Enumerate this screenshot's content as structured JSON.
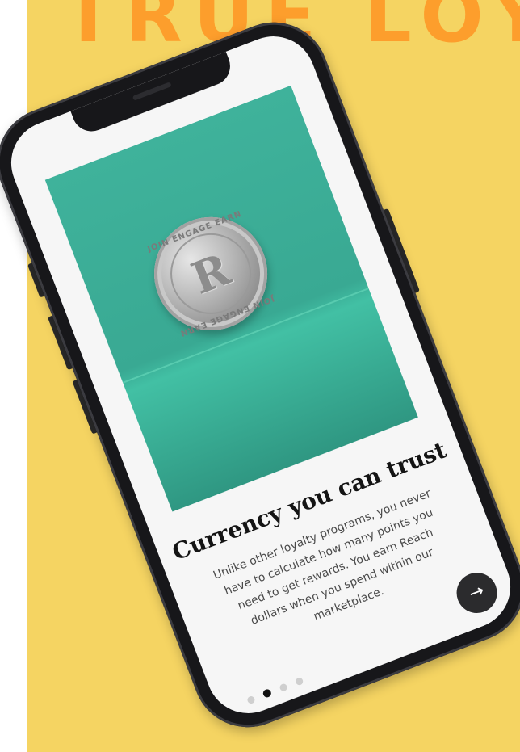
{
  "background": {
    "heading": "TRUE LOY",
    "panel_color": "#f5d462",
    "heading_color": "#fd9e2c"
  },
  "card": {
    "image": {
      "coin_letter": "R",
      "coin_text": "JOIN ENGAGE EARN",
      "color": "#3fb29b"
    },
    "title": "Currency you can trust",
    "body": "Unlike other loyalty programs, you never have to calculate how many points you need to get rewards. You earn Reach dollars when you spend within our marketplace."
  },
  "next_button": {
    "icon": "arrow-right-icon",
    "glyph": "→"
  },
  "pager": {
    "count": 4,
    "active_index": 1
  }
}
